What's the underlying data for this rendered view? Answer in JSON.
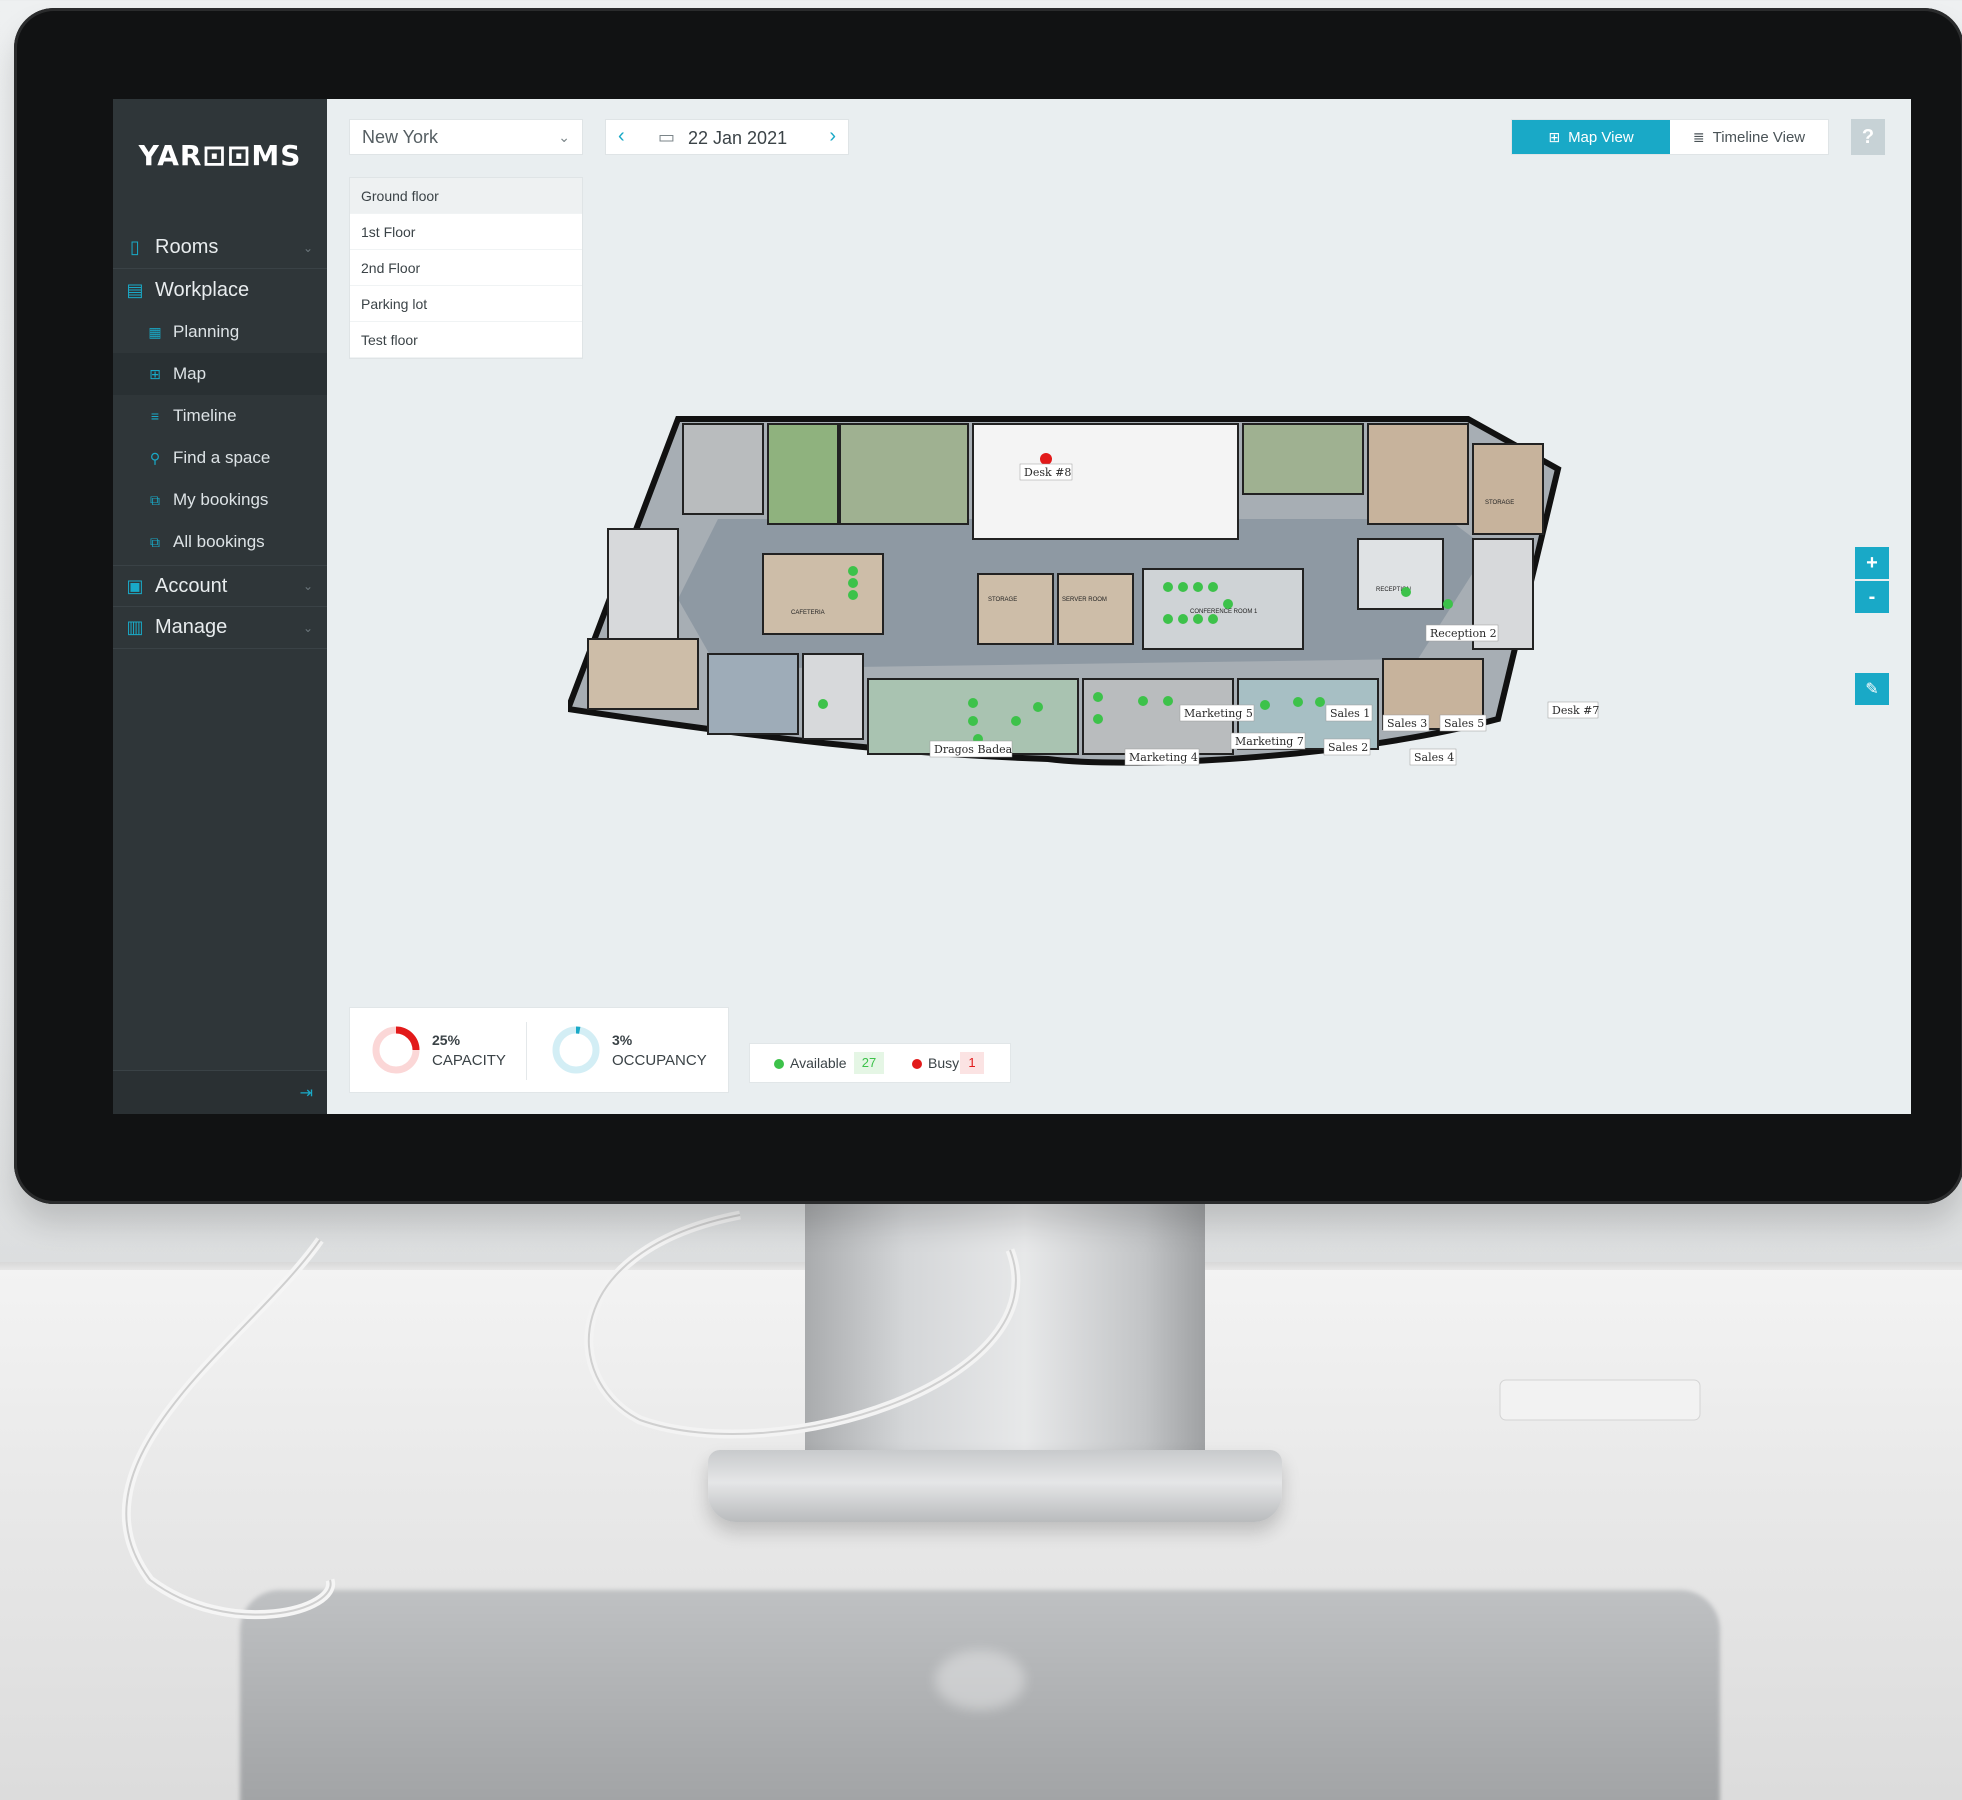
{
  "app": {
    "logo": "YAR⊡⊡MS"
  },
  "sidebar": {
    "items": [
      {
        "label": "Rooms",
        "icon": "door-icon",
        "expandable": true
      },
      {
        "label": "Workplace",
        "icon": "building-icon",
        "expandable": false
      },
      {
        "label": "Account",
        "icon": "account-icon",
        "expandable": true
      },
      {
        "label": "Manage",
        "icon": "manage-icon",
        "expandable": true
      }
    ],
    "workplace_items": [
      {
        "label": "Planning",
        "icon": "planning-icon"
      },
      {
        "label": "Map",
        "icon": "map-icon",
        "active": true
      },
      {
        "label": "Timeline",
        "icon": "timeline-icon"
      },
      {
        "label": "Find a space",
        "icon": "search-icon"
      },
      {
        "label": "My bookings",
        "icon": "bookings-icon"
      },
      {
        "label": "All bookings",
        "icon": "bookings-icon"
      }
    ]
  },
  "toolbar": {
    "location": "New York",
    "date": "22 Jan 2021",
    "map_view_label": "Map View",
    "timeline_view_label": "Timeline View",
    "help_label": "?"
  },
  "floors": [
    "Ground floor",
    "1st Floor",
    "2nd Floor",
    "Parking lot",
    "Test floor"
  ],
  "selected_floor": "Ground floor",
  "map_controls": {
    "zoom_in": "+",
    "zoom_out": "-"
  },
  "floor_plan": {
    "desk_labels": [
      "Desk #8",
      "Reception 2",
      "Dragos Badea",
      "Marketing 5",
      "Marketing 7",
      "Marketing 4",
      "Sales 1",
      "Sales 2",
      "Sales 3",
      "Sales 5",
      "Sales 4",
      "Desk #7"
    ],
    "room_labels": [
      "CAFETERIA",
      "STORAGE",
      "SERVER ROOM",
      "CONFERENCE ROOM 1",
      "RECEPTION",
      "STORAGE"
    ]
  },
  "stats": {
    "capacity_value": "25%",
    "capacity_label": "CAPACITY",
    "capacity_fraction": 0.25,
    "occupancy_value": "3%",
    "occupancy_label": "OCCUPANCY",
    "occupancy_fraction": 0.03
  },
  "legend": {
    "available_label": "Available",
    "available_count": "27",
    "busy_label": "Busy",
    "busy_count": "1"
  },
  "colors": {
    "accent": "#19a9c7",
    "sidebar": "#2f3639",
    "available": "#3dc24a",
    "busy": "#e21a1a",
    "capacity": "#e21a1a"
  }
}
